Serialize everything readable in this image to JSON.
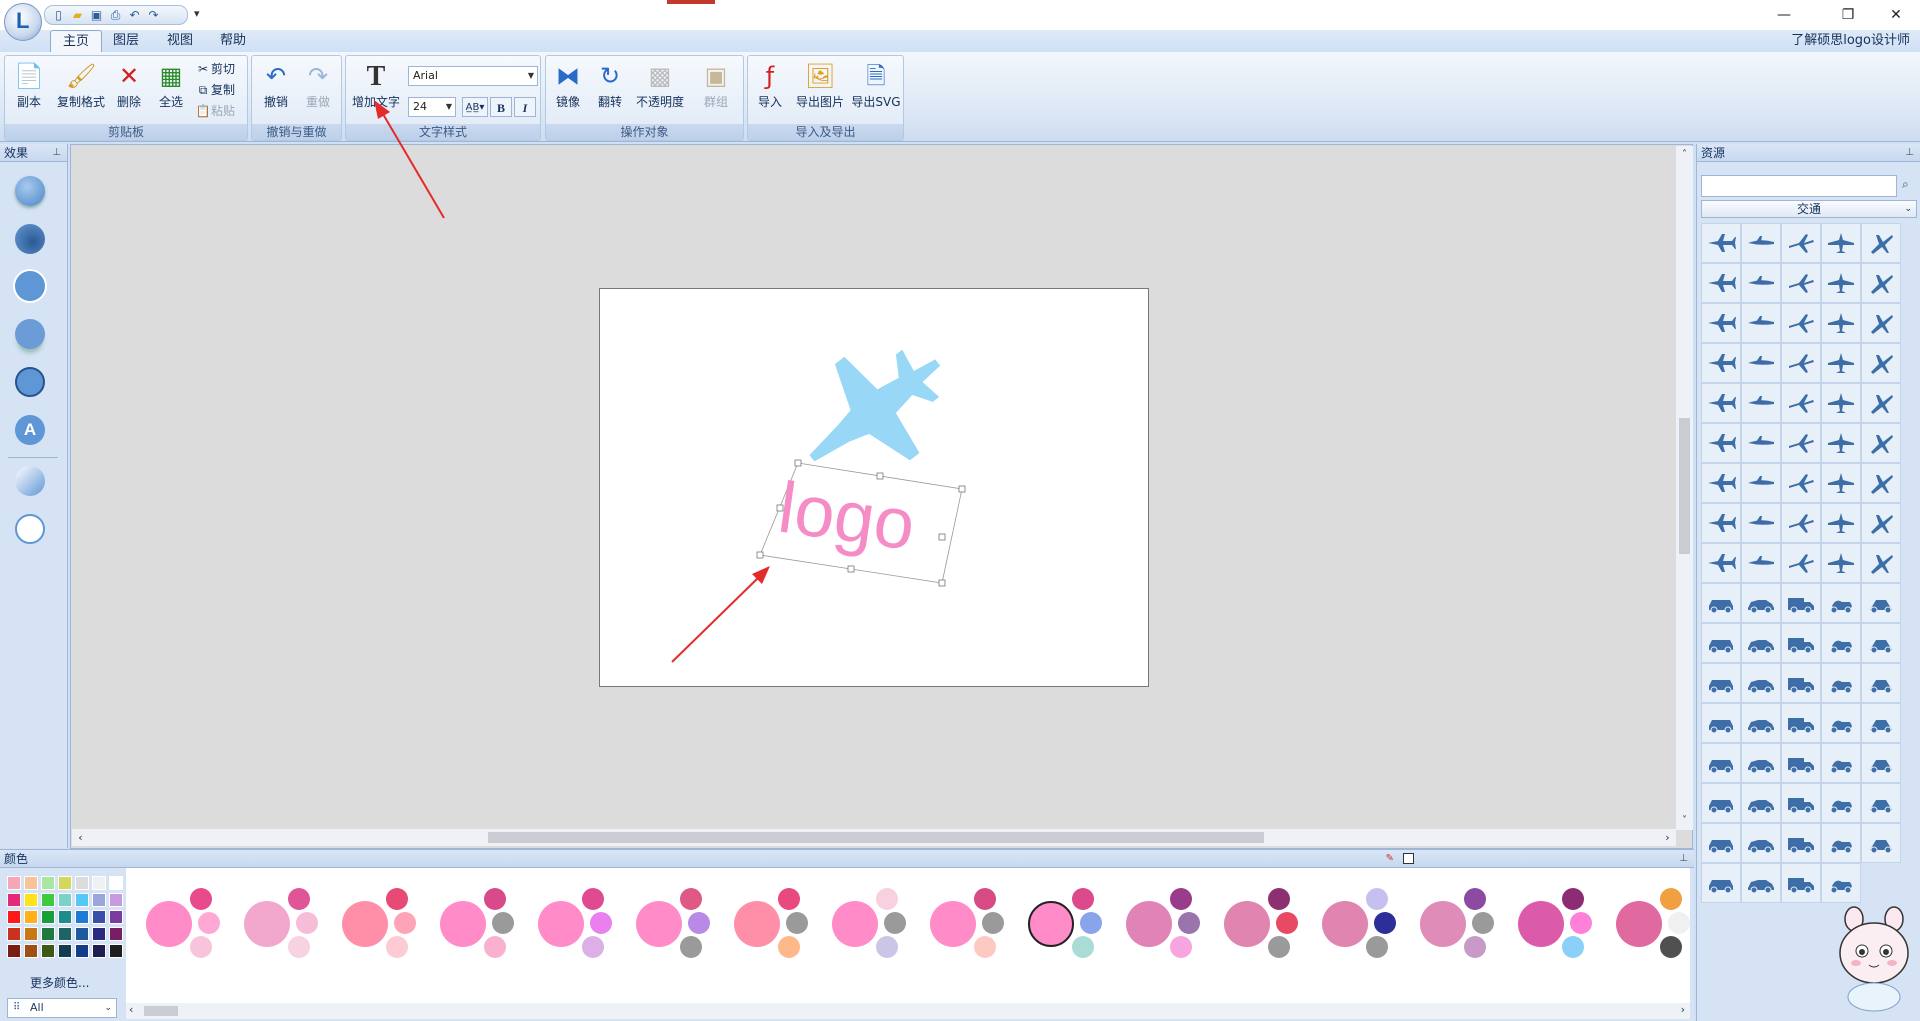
{
  "app": {
    "title": "了解硕思logo设计师"
  },
  "menu": {
    "tabs": [
      "主页",
      "图层",
      "视图",
      "帮助"
    ],
    "active_tab": "主页",
    "help_link": "了解硕思logo设计师"
  },
  "ribbon": {
    "clipboard": {
      "label": "剪贴板",
      "copy_page": "副本",
      "copy_format": "复制格式",
      "delete": "删除",
      "select_all": "全选",
      "cut": "剪切",
      "copy": "复制",
      "paste": "粘贴"
    },
    "undo_redo": {
      "label": "撤销与重做",
      "undo": "撤销",
      "redo": "重做"
    },
    "text_style": {
      "label": "文字样式",
      "add_text": "增加文字",
      "font": "Arial",
      "size": "24",
      "bold": "B",
      "italic": "I"
    },
    "operate": {
      "label": "操作对象",
      "mirror": "镜像",
      "flip": "翻转",
      "opacity": "不透明度",
      "group": "群组"
    },
    "io": {
      "label": "导入及导出",
      "import": "导入",
      "export_image": "导出图片",
      "export_svg": "导出SVG"
    }
  },
  "panels": {
    "effects": "效果",
    "resources": "资源",
    "colors": "颜色"
  },
  "resources": {
    "category": "交通",
    "search_value": ""
  },
  "canvas": {
    "logo_text": "logo",
    "logo_text_color": "#f58cc5",
    "airplane_color": "#99d7f7"
  },
  "colors": {
    "more_colors": "更多颜色...",
    "filter": "All",
    "palette": [
      "#f4a7b9",
      "#f9c39a",
      "#a8e6a1",
      "#d1d95b",
      "#dcdcdc",
      "#f0f0f0",
      "#ffffff",
      "#e6287a",
      "#ffe41a",
      "#3ccb3c",
      "#7ad3c8",
      "#55c8f5",
      "#9aa5d8",
      "#c89be0",
      "#ff1a1a",
      "#ffb01a",
      "#1a9e3a",
      "#1e8c8c",
      "#1e7ad2",
      "#3c4fa8",
      "#7a3c9e",
      "#c8321e",
      "#c87814",
      "#1e7a3c",
      "#1e6464",
      "#1e5aa0",
      "#2a2a80",
      "#7a1e64",
      "#7a1e14",
      "#a05014",
      "#3c5a14",
      "#143c50",
      "#143c8c",
      "#1e1e50",
      "#1e1e1e"
    ],
    "schemes": [
      [
        "#ff8cc8",
        "#e84a8c",
        "#ffa8d4",
        "#f8c4dc"
      ],
      [
        "#f2a8cc",
        "#e05598",
        "#f6bcd8",
        "#f6d2e2"
      ],
      [
        "#ff8fa8",
        "#e84a76",
        "#ffa3b8",
        "#fccbd4"
      ],
      [
        "#ff8cc8",
        "#d84a8a",
        "#9a9a9a",
        "#fcb0d0"
      ],
      [
        "#ff8cc8",
        "#e04a90",
        "#ea80f0",
        "#dcb0e6"
      ],
      [
        "#ff8cc8",
        "#e05884",
        "#b88ae6",
        "#9a9a9a"
      ],
      [
        "#ff8fa8",
        "#e84a80",
        "#9a9a9a",
        "#ffb88a"
      ],
      [
        "#ff8cc8",
        "#f8d0e0",
        "#9a9a9a",
        "#ccc6e6"
      ],
      [
        "#ff8cc8",
        "#d84a84",
        "#9a9a9a",
        "#fccac0"
      ],
      [
        "#ff8cc8",
        "#dc4a8c",
        "#8aa4ec",
        "#a8dcd4"
      ],
      [
        "#e084b8",
        "#9a3c8c",
        "#9a74ac",
        "#f8a4e0"
      ],
      [
        "#e084b0",
        "#8c3070",
        "#e84a64",
        "#9a9a9a"
      ],
      [
        "#e084b0",
        "#c6c0f0",
        "#2e2e9a",
        "#9a9a9a"
      ],
      [
        "#e08cb8",
        "#8c4aa0",
        "#9a9a9a",
        "#c89ac8"
      ],
      [
        "#dc5aaa",
        "#8c2c74",
        "#ff80d8",
        "#8ad0f8"
      ],
      [
        "#e06aa0",
        "#f0a040",
        "#f0f0f0",
        "#505050"
      ]
    ]
  }
}
